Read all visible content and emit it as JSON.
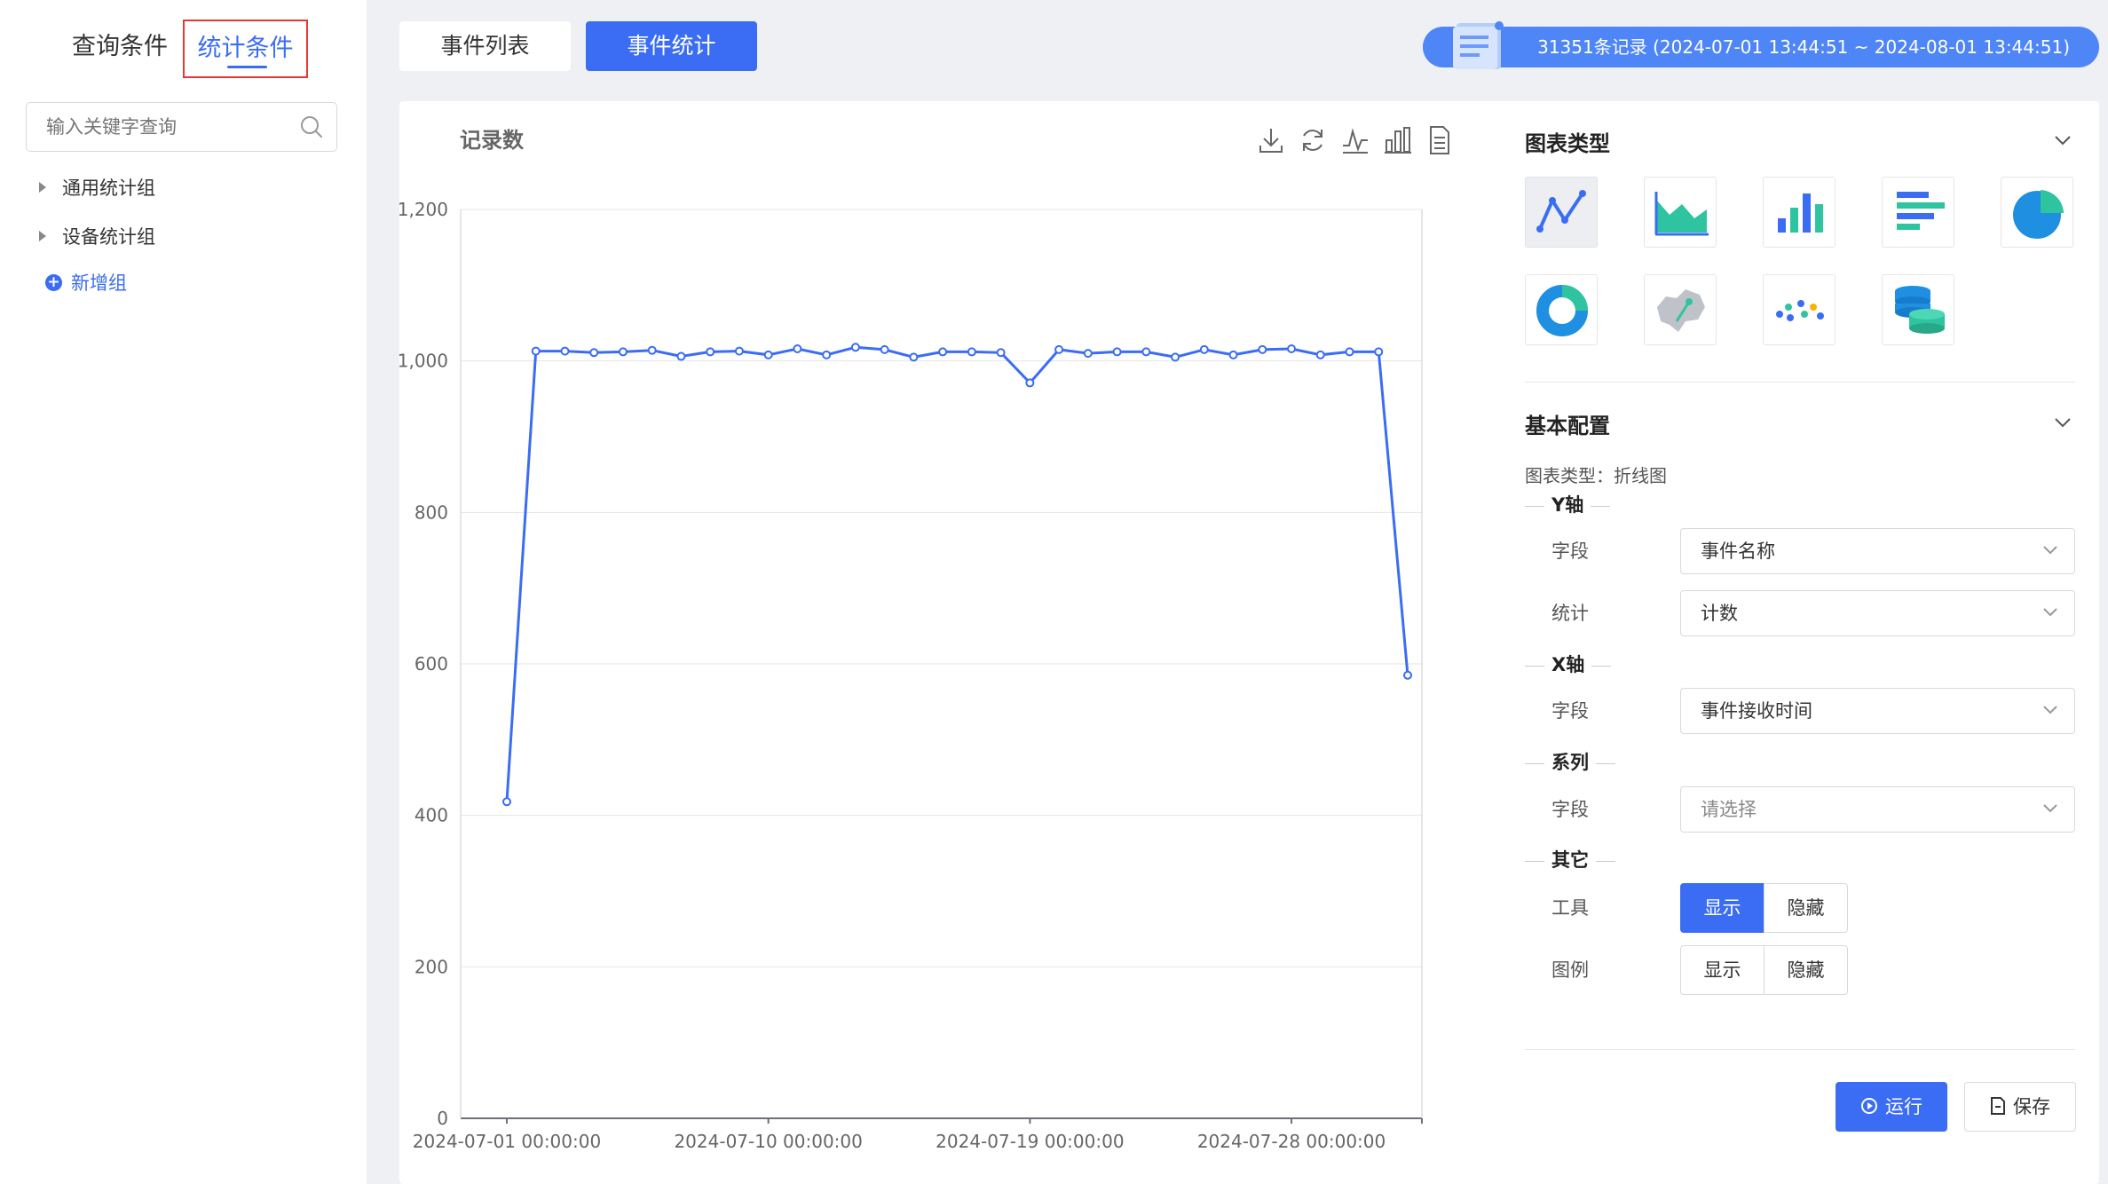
{
  "left_panel": {
    "tabs": [
      "查询条件",
      "统计条件"
    ],
    "search_placeholder": "输入关键字查询",
    "tree": [
      "通用统计组",
      "设备统计组"
    ],
    "add_group_label": "新增组"
  },
  "top_tabs": [
    "事件列表",
    "事件统计"
  ],
  "record_summary": "31351条记录 (2024-07-01 13:44:51 ~ 2024-08-01 13:44:51)",
  "chart_data": {
    "type": "line",
    "title": "记录数",
    "x_labels": [
      "2024-07-01 00:00:00",
      "2024-07-10 00:00:00",
      "2024-07-19 00:00:00",
      "2024-07-28 00:00:00"
    ],
    "y_ticks": [
      "0",
      "200",
      "400",
      "600",
      "800",
      "1,000",
      "1,200"
    ],
    "ylim": [
      0,
      1200
    ],
    "x_dates": [
      "2024-07-01",
      "2024-07-02",
      "2024-07-03",
      "2024-07-04",
      "2024-07-05",
      "2024-07-06",
      "2024-07-07",
      "2024-07-08",
      "2024-07-09",
      "2024-07-10",
      "2024-07-11",
      "2024-07-12",
      "2024-07-13",
      "2024-07-14",
      "2024-07-15",
      "2024-07-16",
      "2024-07-17",
      "2024-07-18",
      "2024-07-19",
      "2024-07-20",
      "2024-07-21",
      "2024-07-22",
      "2024-07-23",
      "2024-07-24",
      "2024-07-25",
      "2024-07-26",
      "2024-07-27",
      "2024-07-28",
      "2024-07-29",
      "2024-07-30",
      "2024-07-31",
      "2024-08-01"
    ],
    "values": [
      418,
      1013,
      1013,
      1011,
      1012,
      1014,
      1006,
      1012,
      1013,
      1008,
      1016,
      1008,
      1018,
      1015,
      1005,
      1012,
      1012,
      1011,
      971,
      1015,
      1010,
      1012,
      1012,
      1005,
      1015,
      1008,
      1015,
      1016,
      1008,
      1012,
      1012,
      585
    ],
    "grid": true,
    "line_color": "#3b6df4"
  },
  "config": {
    "chart_type_title": "图表类型",
    "chart_types": [
      "line-chart-icon",
      "area-chart-icon",
      "bar-chart-icon",
      "horizontal-bar-chart-icon",
      "pie-chart-icon",
      "donut-chart-icon",
      "map-chart-icon",
      "scatter-chart-icon",
      "database-icon"
    ],
    "basic_title": "基本配置",
    "chart_type_info": "图表类型：折线图",
    "y_axis": {
      "title": "Y轴",
      "field_label": "字段",
      "field_value": "事件名称",
      "stat_label": "统计",
      "stat_value": "计数"
    },
    "x_axis": {
      "title": "X轴",
      "field_label": "字段",
      "field_value": "事件接收时间"
    },
    "series": {
      "title": "系列",
      "field_label": "字段",
      "field_placeholder": "请选择"
    },
    "other": {
      "title": "其它",
      "tool_label": "工具",
      "legend_label": "图例",
      "show": "显示",
      "hide": "隐藏"
    },
    "run_label": "运行",
    "save_label": "保存"
  }
}
